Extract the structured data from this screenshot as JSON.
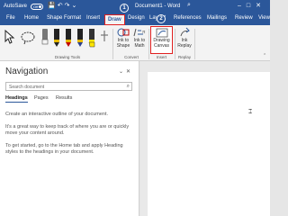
{
  "titlebar": {
    "autosave_label": "AutoSave",
    "autosave_state": "Off",
    "title": "Document1 - Word"
  },
  "tabs": [
    "File",
    "Home",
    "Shape Format",
    "Insert",
    "Draw",
    "Design",
    "Layout",
    "References",
    "Mailings",
    "Review",
    "View"
  ],
  "active_tab": "Draw",
  "badges": {
    "one": "1",
    "two": "2"
  },
  "ribbon": {
    "group_drawing_tools": "Drawing Tools",
    "group_convert": "Convert",
    "group_insert": "Insert",
    "group_replay": "Replay",
    "ink_to_shape": "Ink to Shape",
    "ink_to_math": "Ink to Math",
    "drawing_canvas": "Drawing Canvas",
    "ink_replay": "Ink Replay"
  },
  "navigation": {
    "title": "Navigation",
    "search_placeholder": "Search document",
    "tabs": [
      "Headings",
      "Pages",
      "Results"
    ],
    "active_tab": "Headings",
    "text1": "Create an interactive outline of your document.",
    "text2": "It's a great way to keep track of where you are or quickly move your content around.",
    "text3": "To get started, go to the Home tab and apply Heading styles to the headings in your document."
  },
  "colors": {
    "accent": "#2b579a",
    "highlight": "#e02020"
  }
}
